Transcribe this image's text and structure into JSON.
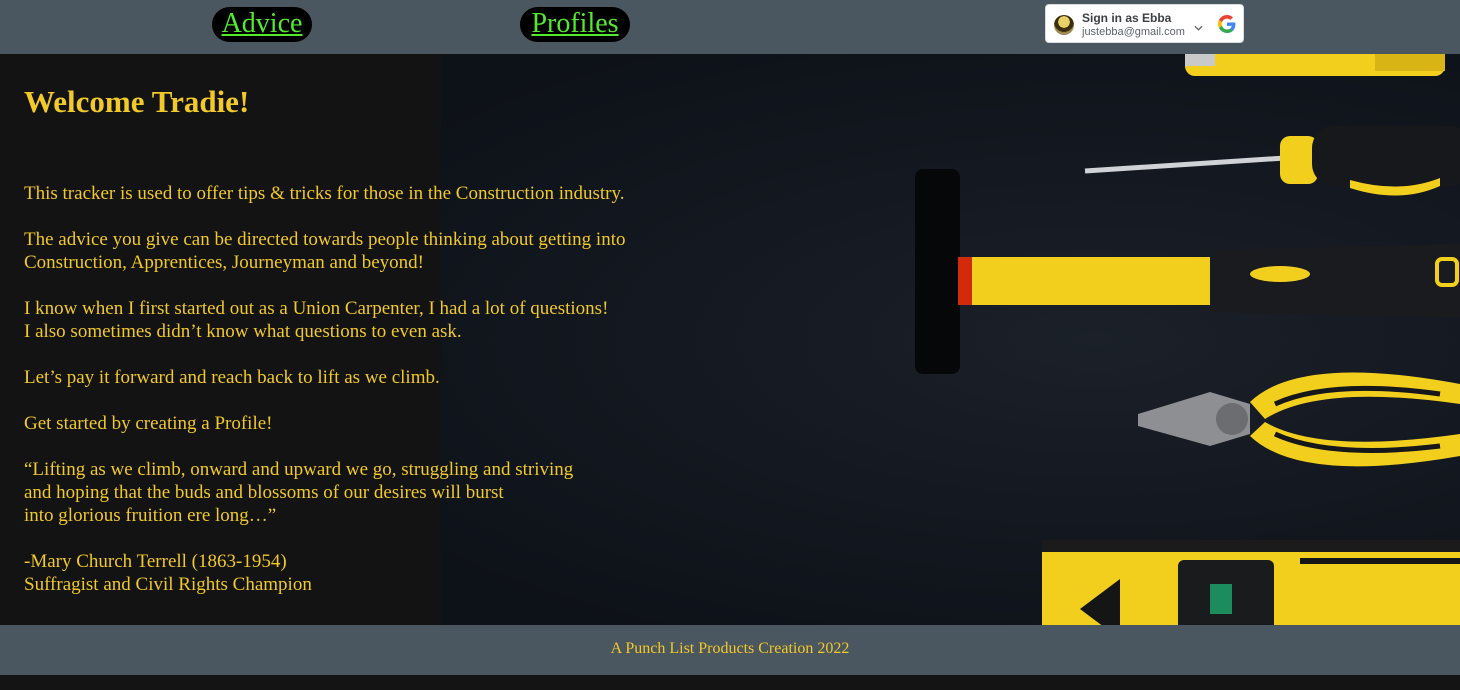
{
  "nav": {
    "advice_label": "Advice",
    "profiles_label": "Profiles"
  },
  "google_signin": {
    "title": "Sign in as Ebba",
    "email": "justebba@gmail.com",
    "icon": "google-g-icon"
  },
  "hero": {
    "heading": "Welcome Tradie!",
    "paragraphs": [
      [
        "This tracker is used to offer tips & tricks for those in the Construction industry."
      ],
      [
        "The advice you give can be directed towards people thinking about getting into",
        "Construction, Apprentices, Journeyman and beyond!"
      ],
      [
        "I know when I first started out as a Union Carpenter, I had a lot of questions!",
        "I also sometimes didn’t know what questions to even ask."
      ],
      [
        "Let’s pay it forward and reach back to lift as we climb."
      ],
      [
        "Get started by creating a Profile!"
      ],
      [
        "“Lifting as we climb, onward and upward we go, struggling and striving",
        "and hoping that the buds and blossoms of our desires will burst",
        "into glorious fruition ere long…”"
      ],
      [
        "-Mary Church Terrell (1863-1954)",
        "Suffragist and Civil Rights Champion"
      ]
    ],
    "background_icons": [
      "utility-knife-icon",
      "screwdriver-icon",
      "hammer-icon",
      "pliers-icon",
      "spirit-level-icon"
    ]
  },
  "footer": {
    "text": "A Punch List Products Creation 2022"
  },
  "colors": {
    "bar": "#4a5660",
    "accent_text": "#f1c928",
    "nav_link": "#53ea2e",
    "tool_yellow": "#f2cf1d"
  }
}
